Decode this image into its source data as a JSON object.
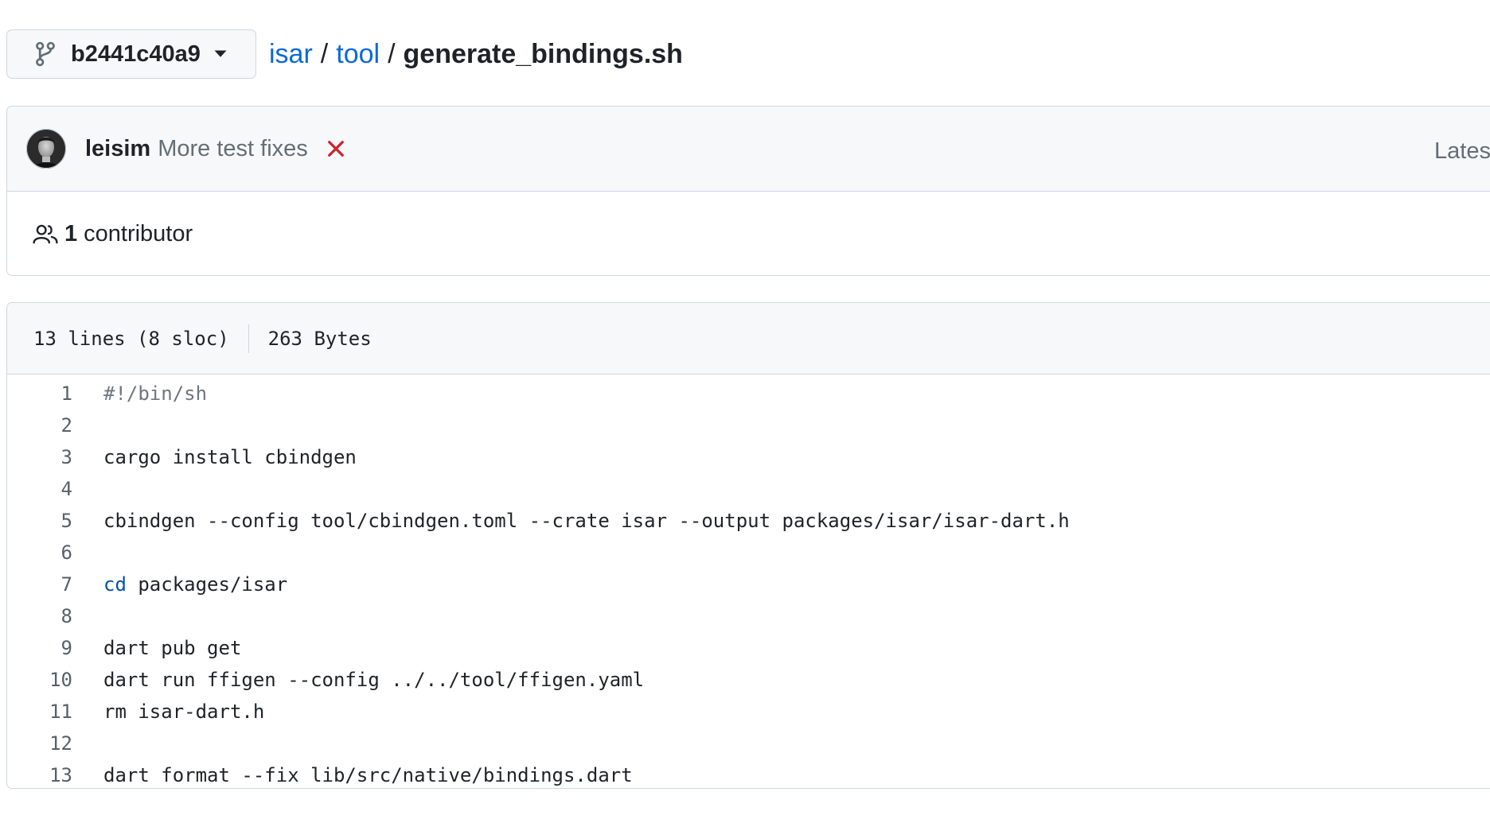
{
  "branch": {
    "name": "b2441c40a9"
  },
  "breadcrumb": {
    "repo": "isar",
    "dir": "tool",
    "file": "generate_bindings.sh",
    "separator": "/"
  },
  "commit": {
    "author": "leisim",
    "message": "More test fixes",
    "latest_label": "Lates"
  },
  "contributors": {
    "count": "1",
    "label": "contributor"
  },
  "file_info": {
    "lines": "13 lines (8 sloc)",
    "size": "263 Bytes"
  },
  "code_lines": [
    {
      "num": "1",
      "text": "#!/bin/sh"
    },
    {
      "num": "2",
      "text": ""
    },
    {
      "num": "3",
      "text": "cargo install cbindgen"
    },
    {
      "num": "4",
      "text": ""
    },
    {
      "num": "5",
      "text": "cbindgen --config tool/cbindgen.toml --crate isar --output packages/isar/isar-dart.h"
    },
    {
      "num": "6",
      "text": ""
    },
    {
      "num": "7",
      "keyword": "cd",
      "text": " packages/isar"
    },
    {
      "num": "8",
      "text": ""
    },
    {
      "num": "9",
      "text": "dart pub get"
    },
    {
      "num": "10",
      "text": "dart run ffigen --config ../../tool/ffigen.yaml"
    },
    {
      "num": "11",
      "text": "rm isar-dart.h"
    },
    {
      "num": "12",
      "text": ""
    },
    {
      "num": "13",
      "text": "dart format --fix lib/src/native/bindings.dart"
    }
  ],
  "icons": {
    "branch": "git-branch-icon",
    "caret": "triangle-down-icon",
    "status": "x-icon",
    "people": "people-icon"
  },
  "colors": {
    "link": "#0969da",
    "status_fail": "#cf222e",
    "muted": "#656d76",
    "border": "#d0d7de",
    "header_bg": "#f6f8fa"
  }
}
